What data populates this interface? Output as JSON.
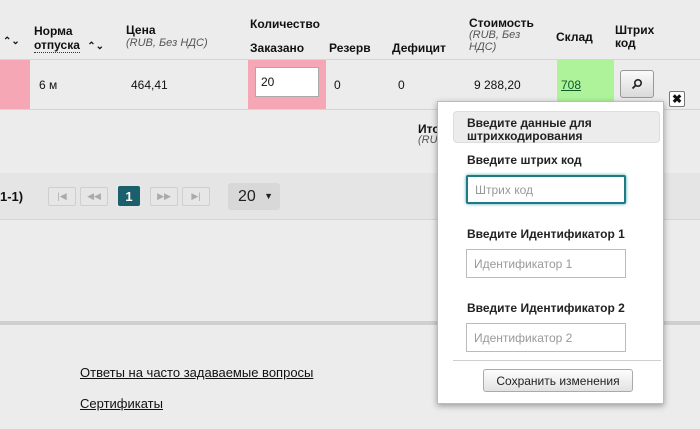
{
  "table": {
    "headers": {
      "norm_line1": "Норма",
      "norm_line2": "отпуска",
      "price": "Цена",
      "price_sub": "(RUB, Без НДС)",
      "quantity": "Количество",
      "ordered": "Заказано",
      "reserve": "Резерв",
      "deficit": "Дефицит",
      "cost": "Стоимость",
      "cost_sub_1": "(RUB, Без",
      "cost_sub_2": "НДС)",
      "stock": "Склад",
      "barcode_1": "Штрих",
      "barcode_2": "код"
    },
    "row": {
      "norm": "6 м",
      "price": "464,41",
      "ordered": "20",
      "reserve": "0",
      "deficit": "0",
      "cost": "9 288,20",
      "stock": "708"
    },
    "total_partial": "Ито",
    "total_partial_sub": "(RU"
  },
  "pagination": {
    "range_partial": "1-1)",
    "current_page": "1",
    "page_size": "20"
  },
  "footer": {
    "faq_link": "Ответы на часто задаваемые вопросы",
    "certs_link": "Сертификаты"
  },
  "popup": {
    "title": "Введите данные для штрихкодирования",
    "barcode_label": "Введите штрих код",
    "barcode_placeholder": "Штрих код",
    "id1_label": "Введите Идентификатор 1",
    "id1_placeholder": "Идентификатор 1",
    "id2_label": "Введите Идентификатор 2",
    "id2_placeholder": "Идентификатор 2",
    "save_label": "Сохранить изменения"
  },
  "colors": {
    "highlight_pink": "#f6a7b5",
    "highlight_green": "#aef39a",
    "accent_teal": "#1a5f6b"
  }
}
